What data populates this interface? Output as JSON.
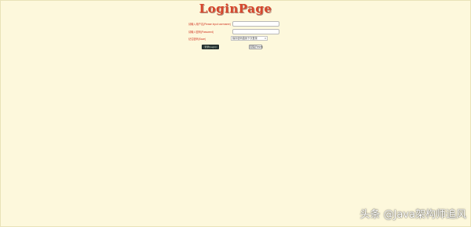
{
  "page": {
    "title": "LoginPage",
    "background_color": "#fdf8dc",
    "accent_color": "#d8472d"
  },
  "form": {
    "username_label": "请输入用户名(Please input username)",
    "username_value": "",
    "password_label": "请输入密码(Password)",
    "password_value": "",
    "save_label": "记住密码(Save)",
    "save_selected": "保存密码直到下次登录",
    "login_button_label": "登录(Login)",
    "reset_button_label": "清除(Reset)"
  },
  "watermark": {
    "text": "头条 @Java架构师追风"
  }
}
